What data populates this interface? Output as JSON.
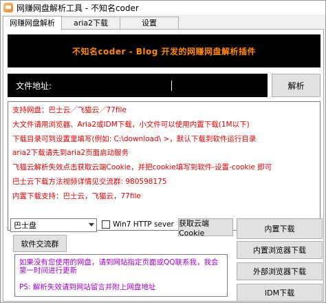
{
  "window": {
    "title": "网赚网盘解析工具 - 不知名coder"
  },
  "tabs": [
    {
      "label": "网赚网盘解析"
    },
    {
      "label": "aria2下载"
    },
    {
      "label": "设置"
    }
  ],
  "banner": {
    "text": "不知名coder - Blog 开发的网赚网盘解析插件"
  },
  "url_row": {
    "label": "文件地址:",
    "value": "",
    "parse_button": "解析"
  },
  "log_lines": [
    "支持网盘：巴士云／飞猫云／77file",
    "大文件请用浏览器、Aria2或IDM下载，小文件可以使用内置下载(1M以下)",
    "下载目录可到设置里填写(例如: C:\\download\\ >，默认下载到软件运行目录",
    "aria2下载请先到aria2页面启动服务",
    "飞猫云解析失效点击获取云端Cookie，并把cookie填写到软件-设置-cookie 即可",
    "巴士云下载方法视频详情见交流群: 980598175",
    "内置下载支持：巴士云，飞猫云，77file"
  ],
  "controls": {
    "disk_select": "巴士盘",
    "win7_http_server": {
      "label": "Win7 HTTP sever",
      "checked": false
    },
    "get_cookie_button": "获取云端Cookie",
    "builtin_download_button": "内置下载",
    "software_group_button": "软件交流群",
    "builtin_browser_download_button": "内置浏览器下载",
    "external_browser_download_button": "外部浏览器下载",
    "idm_download_button": "IDM下载"
  },
  "notice": {
    "text": "如果没有您使用的网盘，请到网站指定页面或QQ联系我，我会第一时间进行更新",
    "ps": "PS: 解析失效请到网站留言并附上网盘地址"
  },
  "colors": {
    "log_text": "#e00000",
    "banner_text": "#ff8a00",
    "notice_text": "#a000d0"
  }
}
